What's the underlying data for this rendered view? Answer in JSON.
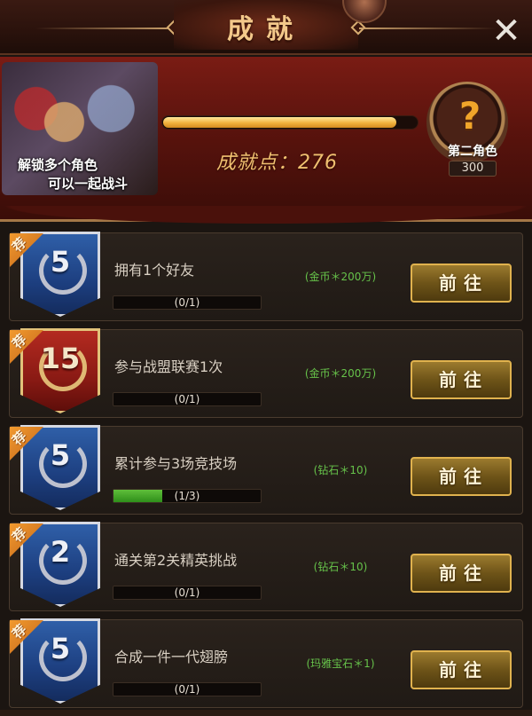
{
  "header": {
    "title": "成就",
    "close_label": "✕"
  },
  "banner": {
    "hero_caption_line1": "解锁多个角色",
    "hero_caption_line2": "可以一起战斗",
    "progress_fraction": 0.92,
    "points_label": "成就点：",
    "points_value": "276",
    "reward_symbol": "?",
    "reward_label": "第二角色",
    "reward_points": "300"
  },
  "tasks": [
    {
      "ribbon": "荐",
      "badge_number": "5",
      "badge_color": "blue",
      "title": "拥有1个好友",
      "progress_text": "(0/1)",
      "progress_fraction": 0,
      "reward": "(金币＊200万)",
      "button_label": "前往"
    },
    {
      "ribbon": "荐",
      "badge_number": "15",
      "badge_color": "red",
      "title": "参与战盟联赛1次",
      "progress_text": "(0/1)",
      "progress_fraction": 0,
      "reward": "(金币＊200万)",
      "button_label": "前往"
    },
    {
      "ribbon": "荐",
      "badge_number": "5",
      "badge_color": "blue",
      "title": "累计参与3场竞技场",
      "progress_text": "(1/3)",
      "progress_fraction": 0.3333,
      "reward": "(钻石＊10)",
      "button_label": "前往"
    },
    {
      "ribbon": "荐",
      "badge_number": "2",
      "badge_color": "blue",
      "title": "通关第2关精英挑战",
      "progress_text": "(0/1)",
      "progress_fraction": 0,
      "reward": "(钻石＊10)",
      "button_label": "前往"
    },
    {
      "ribbon": "荐",
      "badge_number": "5",
      "badge_color": "blue",
      "title": "合成一件一代翅膀",
      "progress_text": "(0/1)",
      "progress_fraction": 0,
      "reward": "(玛雅宝石＊1)",
      "button_label": "前往"
    }
  ],
  "icons": {
    "close": "close-icon",
    "laurel": "laurel-icon",
    "question": "question-mark-icon"
  },
  "colors": {
    "accent_gold": "#f0c070",
    "reward_green": "#66c24a",
    "progress_green": "#3fa52a",
    "badge_blue": "#1d3f80",
    "badge_red": "#8a1a14"
  }
}
